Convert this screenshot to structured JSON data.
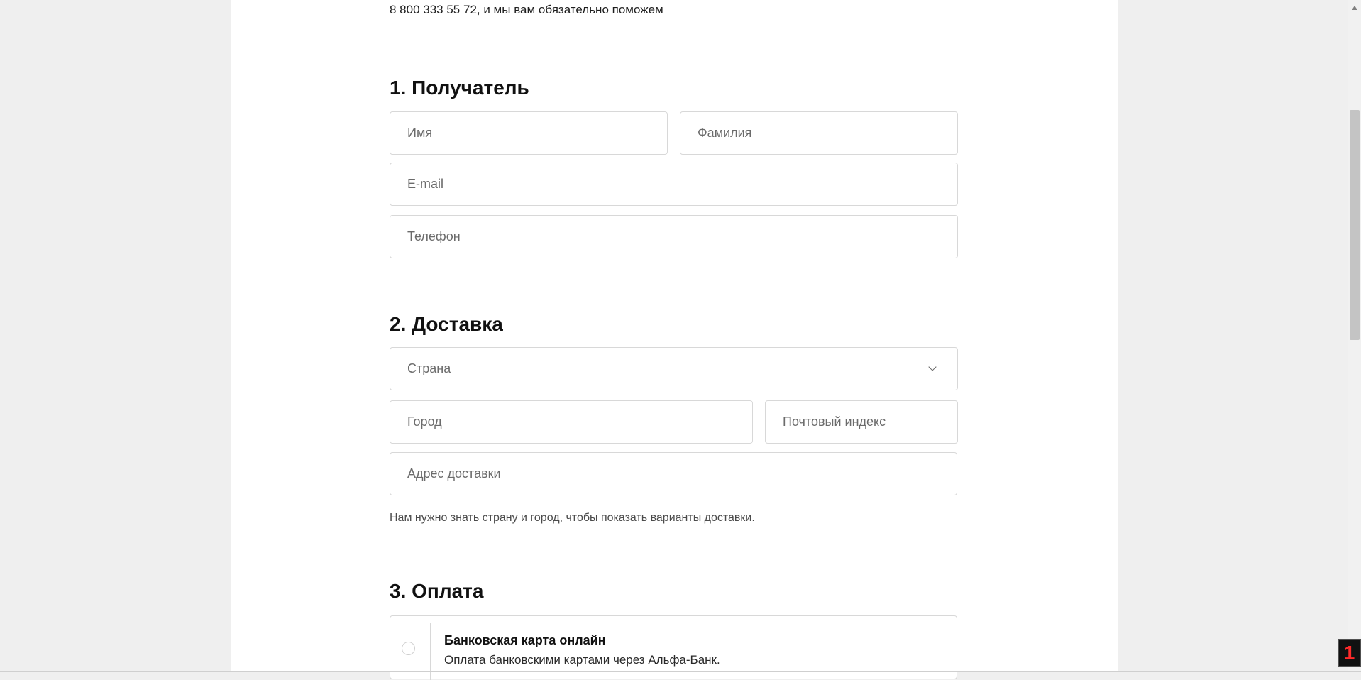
{
  "top_text": "8 800 333 55 72, и мы вам обязательно поможем",
  "sections": {
    "recipient": {
      "title": "1. Получатель",
      "first_name": {
        "placeholder": "Имя",
        "value": ""
      },
      "last_name": {
        "placeholder": "Фамилия",
        "value": ""
      },
      "email": {
        "placeholder": "E-mail",
        "value": ""
      },
      "phone": {
        "placeholder": "Телефон",
        "value": ""
      }
    },
    "delivery": {
      "title": "2. Доставка",
      "country": {
        "placeholder": "Страна"
      },
      "city": {
        "placeholder": "Город",
        "value": ""
      },
      "postal_code": {
        "placeholder": "Почтовый индекс",
        "value": ""
      },
      "address": {
        "placeholder": "Адрес доставки",
        "value": ""
      },
      "hint": "Нам нужно знать страну и город, чтобы показать варианты доставки."
    },
    "payment": {
      "title": "3. Оплата",
      "option": {
        "title": "Банковская карта онлайн",
        "description": "Оплата банковскими картами через Альфа-Банк."
      }
    }
  },
  "badge": {
    "text": "1"
  },
  "icons": {
    "country_dropdown": "chevron-down-icon",
    "scroll_up": "scroll-up-arrow-icon"
  },
  "colors": {
    "page_background": "#efefef",
    "panel_background": "#ffffff",
    "border": "#d8d8d8",
    "heading": "#111111",
    "badge_text": "#ff2a2a"
  }
}
